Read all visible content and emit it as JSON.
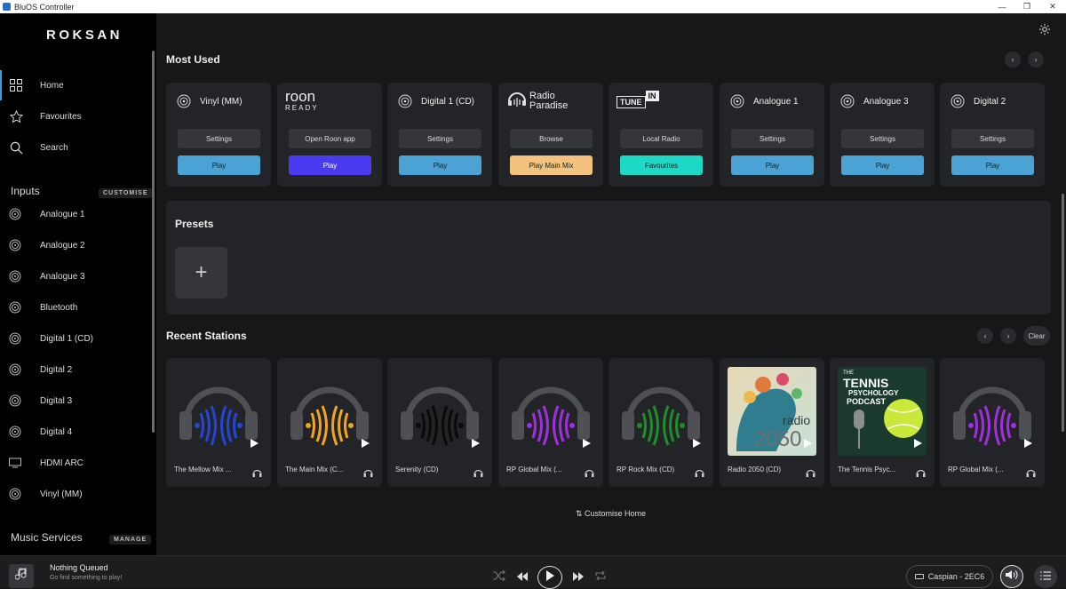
{
  "window": {
    "title": "BluOS Controller",
    "minimize": "—",
    "maximize": "❐",
    "close": "✕"
  },
  "brand": {
    "logo": "ROKSAN"
  },
  "nav": [
    {
      "label": "Home",
      "icon": "home-grid-icon"
    },
    {
      "label": "Favourites",
      "icon": "star-icon"
    },
    {
      "label": "Search",
      "icon": "search-icon"
    }
  ],
  "inputs_section": {
    "title": "Inputs",
    "button": "CUSTOMISE"
  },
  "inputs": [
    {
      "label": "Analogue 1",
      "icon": "input-icon"
    },
    {
      "label": "Analogue 2",
      "icon": "input-icon"
    },
    {
      "label": "Analogue 3",
      "icon": "input-icon"
    },
    {
      "label": "Bluetooth",
      "icon": "input-icon"
    },
    {
      "label": "Digital 1 (CD)",
      "icon": "input-icon"
    },
    {
      "label": "Digital 2",
      "icon": "input-icon"
    },
    {
      "label": "Digital 3",
      "icon": "input-icon"
    },
    {
      "label": "Digital 4",
      "icon": "input-icon"
    },
    {
      "label": "HDMI ARC",
      "icon": "tv-icon"
    },
    {
      "label": "Vinyl (MM)",
      "icon": "input-icon"
    }
  ],
  "music_services": {
    "title": "Music Services",
    "button": "MANAGE"
  },
  "most_used": {
    "title": "Most Used",
    "cards": [
      {
        "title": "Vinyl (MM)",
        "btn1": "Settings",
        "btn2": "Play",
        "btn2_color": "#4aa3d4"
      },
      {
        "title": "",
        "logo_line1": "roon",
        "logo_line2": "READY",
        "btn1": "Open Roon app",
        "btn2": "Play",
        "btn2_color": "#4b3bf0"
      },
      {
        "title": "Digital 1 (CD)",
        "btn1": "Settings",
        "btn2": "Play",
        "btn2_color": "#4aa3d4"
      },
      {
        "title": "",
        "logo_line1": "Radio",
        "logo_line2": "Paradise",
        "btn1": "Browse",
        "btn2": "Play Main Mix",
        "btn2_color": "#f2c27e"
      },
      {
        "title": "",
        "logo_line1": "TUNE",
        "logo_line2": "IN",
        "btn1": "Local Radio",
        "btn2": "Favourites",
        "btn2_color": "#1dd8c4"
      },
      {
        "title": "Analogue 1",
        "btn1": "Settings",
        "btn2": "Play",
        "btn2_color": "#4aa3d4"
      },
      {
        "title": "Analogue 3",
        "btn1": "Settings",
        "btn2": "Play",
        "btn2_color": "#4aa3d4"
      },
      {
        "title": "Digital 2",
        "btn1": "Settings",
        "btn2": "Play",
        "btn2_color": "#4aa3d4"
      }
    ]
  },
  "presets": {
    "title": "Presets",
    "add": "+"
  },
  "recent": {
    "title": "Recent Stations",
    "clear": "Clear",
    "stations": [
      {
        "name": "The Mellow Mix ...",
        "wave_color": "#2446d6",
        "art": "headphones"
      },
      {
        "name": "The Main Mix (C...",
        "wave_color": "#f0a522",
        "art": "headphones"
      },
      {
        "name": "Serenity (CD)",
        "wave_color": "#0a0a0a",
        "art": "headphones"
      },
      {
        "name": "RP Global Mix (...",
        "wave_color": "#a12fe0",
        "art": "headphones"
      },
      {
        "name": "RP Rock Mix (CD)",
        "wave_color": "#1e8e2a",
        "art": "headphones"
      },
      {
        "name": "Radio 2050 (CD)",
        "art": "radio2050",
        "art_text1": "radio",
        "art_text2": "2050"
      },
      {
        "name": "The Tennis Psyc...",
        "art": "tennis",
        "art_text1": "THE",
        "art_text2": "TENNIS",
        "art_text3": "PSYCHOLOGY",
        "art_text4": "PODCAST"
      },
      {
        "name": "RP Global Mix (...",
        "wave_color": "#a12fe0",
        "art": "headphones"
      }
    ]
  },
  "customise_home": "⇅ Customise Home",
  "player": {
    "title": "Nothing Queued",
    "subtitle": "Go find something to play!",
    "zone": "Caspian - 2EC6"
  }
}
